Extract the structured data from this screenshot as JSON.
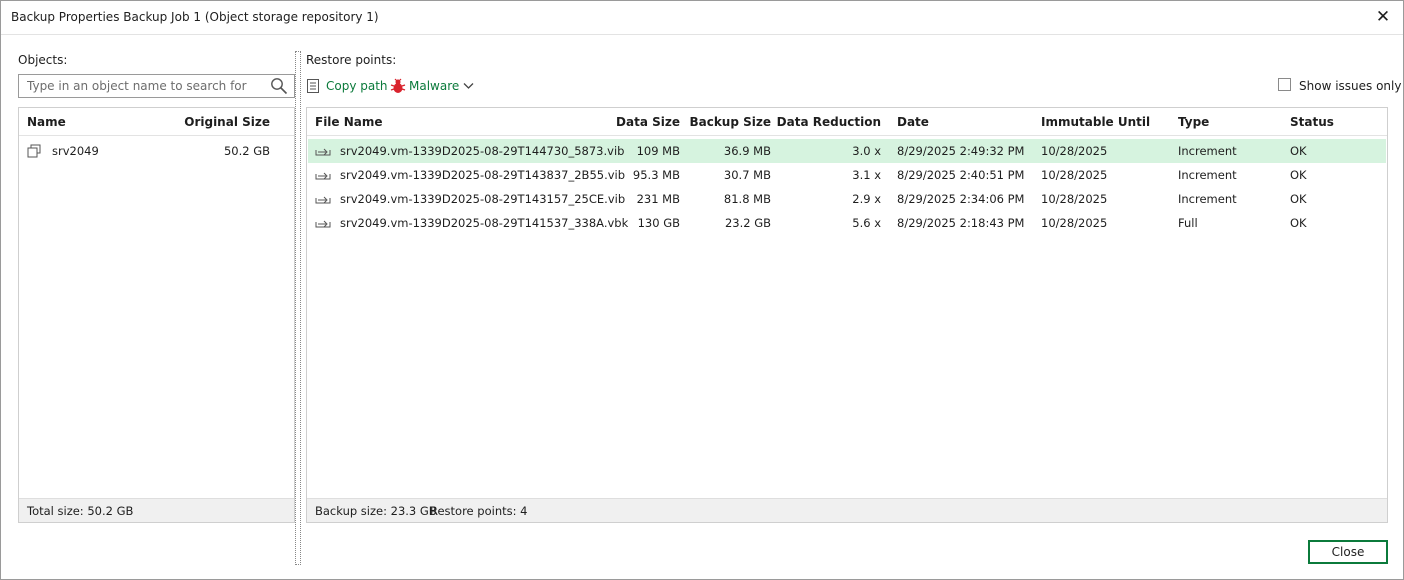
{
  "window": {
    "title": "Backup Properties Backup Job 1 (Object storage repository 1)"
  },
  "objects": {
    "label": "Objects:",
    "search_placeholder": "Type in an object name to search for",
    "columns": {
      "name": "Name",
      "original_size": "Original Size"
    },
    "rows": [
      {
        "name": "srv2049",
        "original_size": "50.2 GB"
      }
    ],
    "footer": "Total size: 50.2 GB"
  },
  "restore": {
    "label": "Restore points:",
    "toolbar": {
      "copy_path": "Copy path",
      "malware": "Malware",
      "show_issues": "Show issues only"
    },
    "columns": {
      "file_name": "File Name",
      "data_size": "Data Size",
      "backup_size": "Backup Size",
      "data_reduction": "Data Reduction",
      "date": "Date",
      "immutable_until": "Immutable Until",
      "type": "Type",
      "status": "Status"
    },
    "rows": [
      {
        "file_name": "srv2049.vm-1339D2025-08-29T144730_5873.vib",
        "data_size": "109 MB",
        "backup_size": "36.9 MB",
        "data_reduction": "3.0 x",
        "date": "8/29/2025 2:49:32 PM",
        "immutable_until": "10/28/2025",
        "type": "Increment",
        "status": "OK"
      },
      {
        "file_name": "srv2049.vm-1339D2025-08-29T143837_2B55.vib",
        "data_size": "95.3 MB",
        "backup_size": "30.7 MB",
        "data_reduction": "3.1 x",
        "date": "8/29/2025 2:40:51 PM",
        "immutable_until": "10/28/2025",
        "type": "Increment",
        "status": "OK"
      },
      {
        "file_name": "srv2049.vm-1339D2025-08-29T143157_25CE.vib",
        "data_size": "231 MB",
        "backup_size": "81.8 MB",
        "data_reduction": "2.9 x",
        "date": "8/29/2025 2:34:06 PM",
        "immutable_until": "10/28/2025",
        "type": "Increment",
        "status": "OK"
      },
      {
        "file_name": "srv2049.vm-1339D2025-08-29T141537_338A.vbk",
        "data_size": "130 GB",
        "backup_size": "23.2 GB",
        "data_reduction": "5.6 x",
        "date": "8/29/2025 2:18:43 PM",
        "immutable_until": "10/28/2025",
        "type": "Full",
        "status": "OK"
      }
    ],
    "footer": {
      "backup_size": "Backup size: 23.3 GB",
      "restore_points": "Restore points: 4"
    }
  },
  "buttons": {
    "close": "Close"
  },
  "colors": {
    "accent": "#0b7a3b",
    "selected_row": "#d6f3df",
    "malware_icon": "#d9232d"
  }
}
